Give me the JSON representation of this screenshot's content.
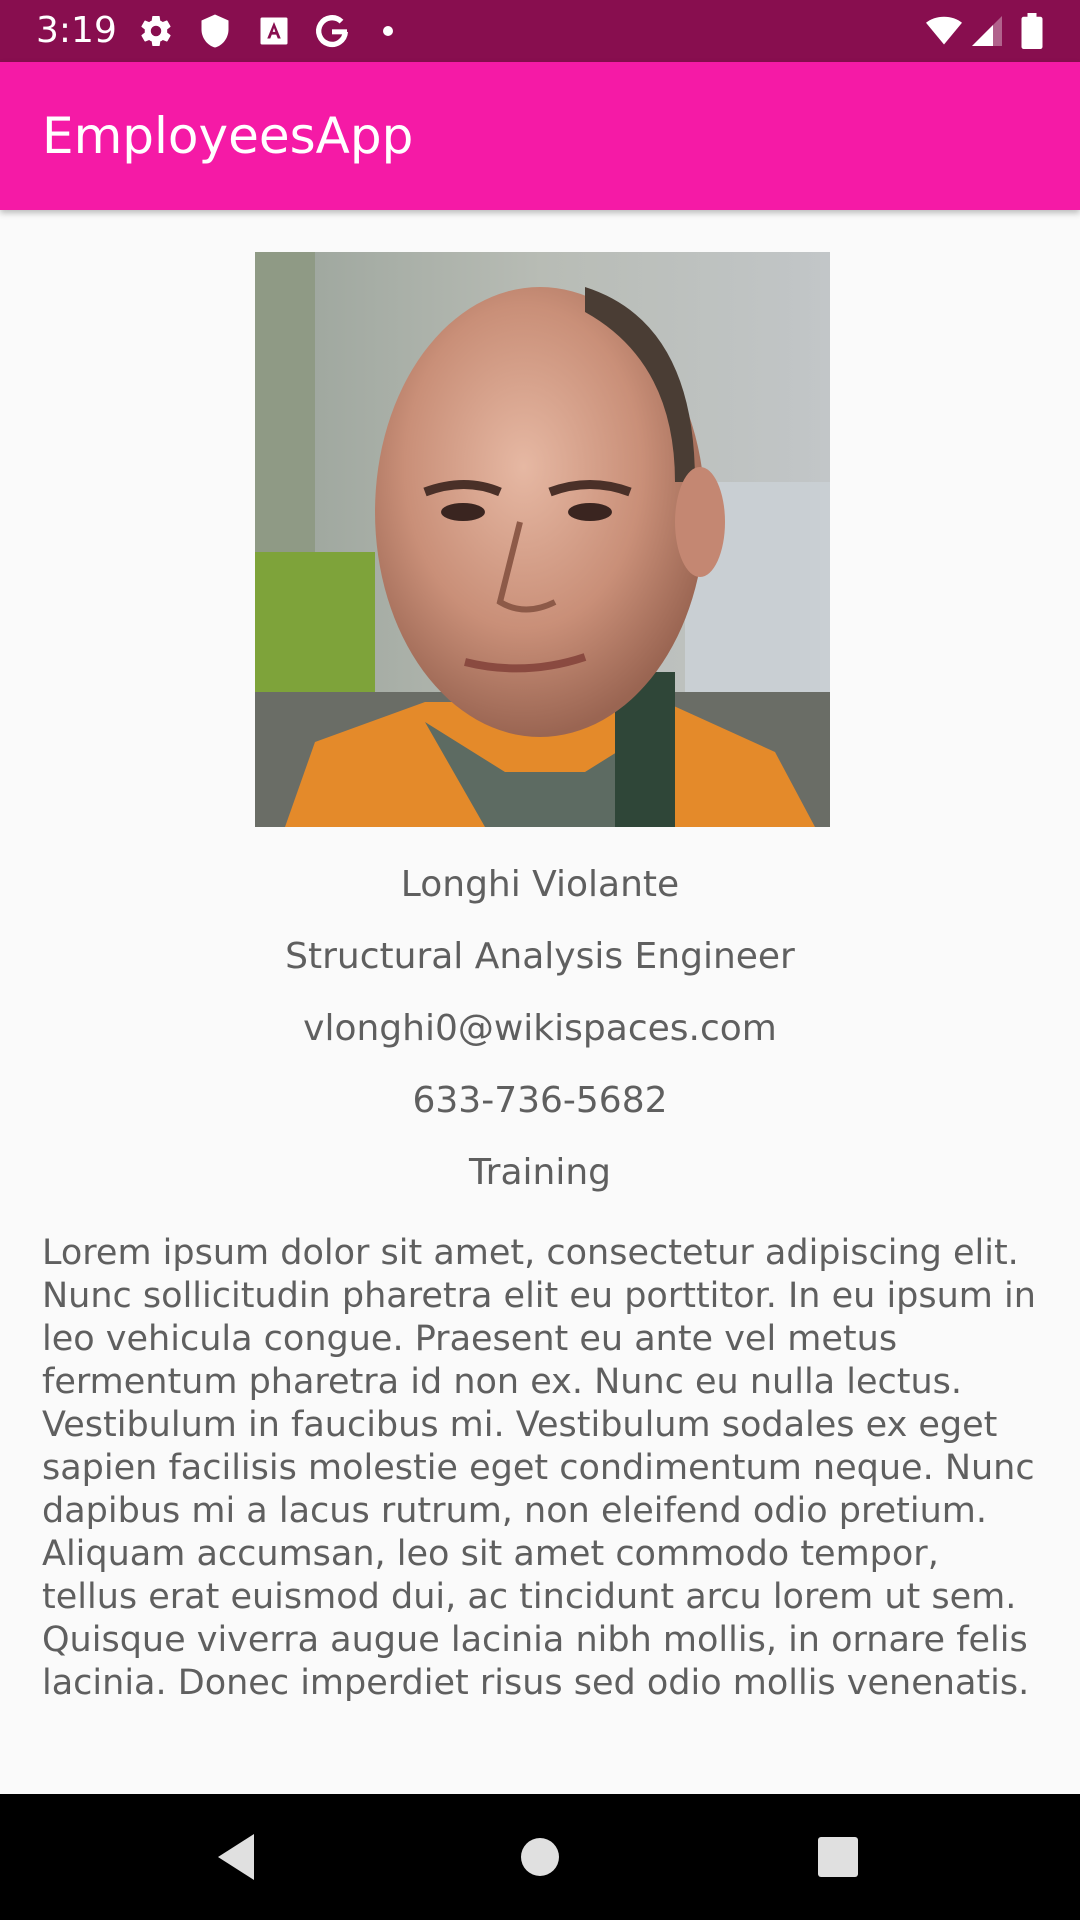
{
  "status_bar": {
    "time": "3:19",
    "icons": [
      "settings-icon",
      "shield-icon",
      "font-icon",
      "google-icon",
      "dot-icon",
      "wifi-icon",
      "signal-icon",
      "battery-icon"
    ]
  },
  "app_bar": {
    "title": "EmployeesApp",
    "color": "#f51aa6"
  },
  "employee": {
    "name": "Longhi Violante",
    "title": "Structural Analysis Engineer",
    "email": "vlonghi0@wikispaces.com",
    "phone": "633-736-5682",
    "department": "Training",
    "description": "Lorem ipsum dolor sit amet, consectetur adipiscing elit. Nunc sollicitudin pharetra elit eu porttitor. In eu ipsum in leo vehicula congue. Praesent eu ante vel metus fermentum pharetra id non ex. Nunc eu nulla lectus. Vestibulum in faucibus mi. Vestibulum sodales ex eget sapien facilisis molestie eget condimentum neque. Nunc dapibus mi a lacus rutrum, non eleifend odio pretium. Aliquam accumsan, leo sit amet commodo tempor, tellus erat euismod dui, ac tincidunt arcu lorem ut sem. Quisque viverra augue lacinia nibh mollis, in ornare felis lacinia. Donec imperdiet risus sed odio mollis venenatis."
  },
  "nav_bar": {
    "buttons": [
      "back-icon",
      "home-icon",
      "recents-icon"
    ]
  }
}
